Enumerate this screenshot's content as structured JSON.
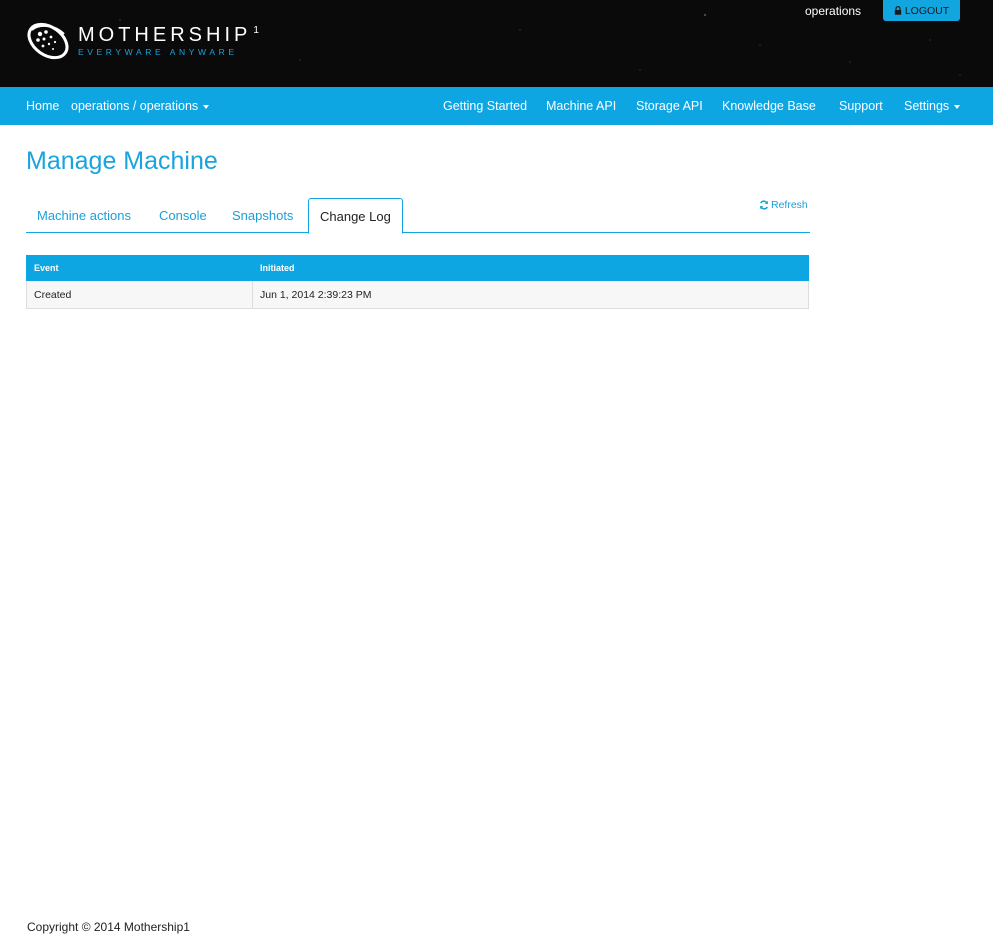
{
  "brand": {
    "name": "MOTHERSHIP",
    "superscript": "1",
    "tagline": "EVERYWARE ANYWARE"
  },
  "user": {
    "name": "operations",
    "logout_label": "LOGOUT"
  },
  "nav": {
    "home": "Home",
    "org": "operations / operations",
    "getting_started": "Getting Started",
    "machine_api": "Machine API",
    "storage_api": "Storage API",
    "knowledge_base": "Knowledge Base",
    "support": "Support",
    "settings": "Settings"
  },
  "page": {
    "title": "Manage Machine"
  },
  "tabs": [
    {
      "label": "Machine actions"
    },
    {
      "label": "Console"
    },
    {
      "label": "Snapshots"
    },
    {
      "label": "Change Log",
      "active": true
    }
  ],
  "refresh_label": "Refresh",
  "change_log": {
    "columns": [
      "Event",
      "Initiated"
    ],
    "rows": [
      [
        "Created",
        "Jun 1, 2014 2:39:23 PM"
      ]
    ]
  },
  "footer": {
    "copyright": "Copyright © 2014 Mothership1"
  },
  "colors": {
    "accent": "#0ea5e3",
    "header_bg": "#0a0a0a",
    "title": "#1aa3dc"
  },
  "icons": {
    "logo": "mothership-logo-icon",
    "logout": "lock-icon",
    "refresh": "refresh-icon",
    "dropdown": "caret-down-icon"
  }
}
